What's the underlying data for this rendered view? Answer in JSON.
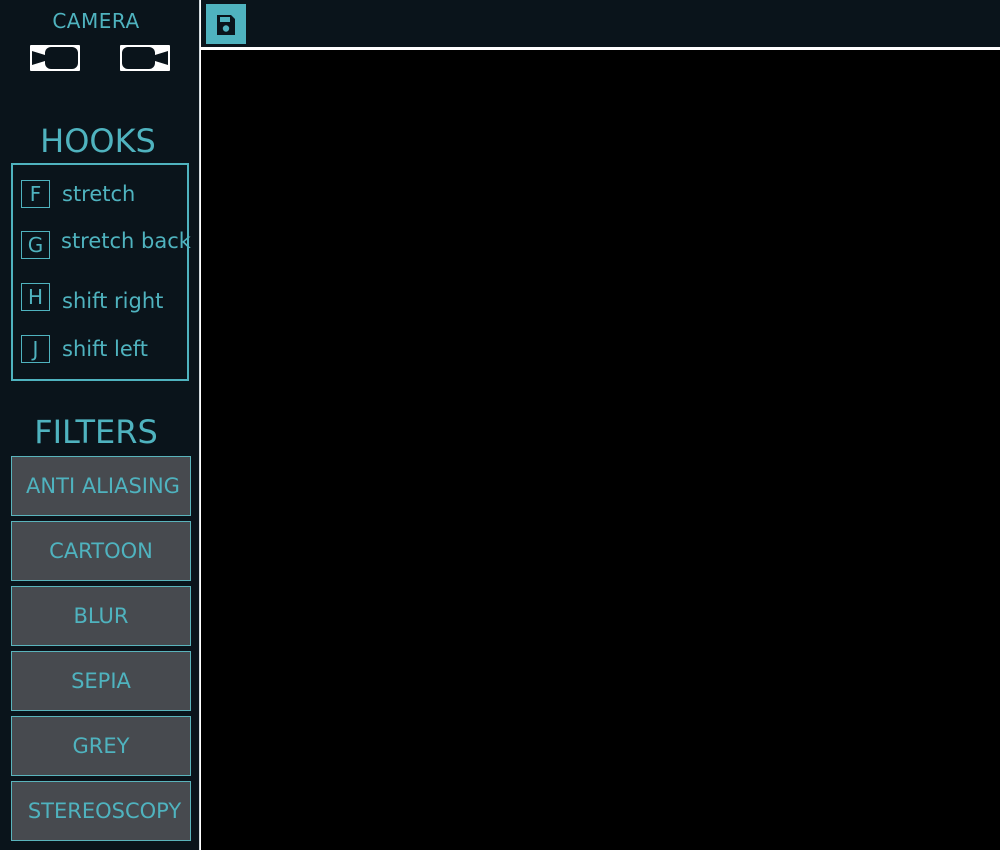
{
  "colors": {
    "accent": "#4fb3bf",
    "sidebar_bg": "#0a141b",
    "button_bg": "#474a4f",
    "canvas_bg": "#000000"
  },
  "camera": {
    "title": "CAMERA",
    "buttons": [
      {
        "icon": "camera-left-icon"
      },
      {
        "icon": "camera-right-icon"
      }
    ]
  },
  "hooks": {
    "title": "HOOKS",
    "items": [
      {
        "key": "F",
        "label": "stretch"
      },
      {
        "key": "G",
        "label": "stretch back"
      },
      {
        "key": "H",
        "label": "shift right"
      },
      {
        "key": "J",
        "label": "shift left"
      }
    ]
  },
  "filters": {
    "title": "FILTERS",
    "items": [
      {
        "label": "ANTI ALIASING"
      },
      {
        "label": "CARTOON"
      },
      {
        "label": "BLUR"
      },
      {
        "label": "SEPIA"
      },
      {
        "label": "GREY"
      },
      {
        "label": "STEREOSCOPY"
      }
    ]
  },
  "toolbar": {
    "save_icon": "save-icon"
  }
}
